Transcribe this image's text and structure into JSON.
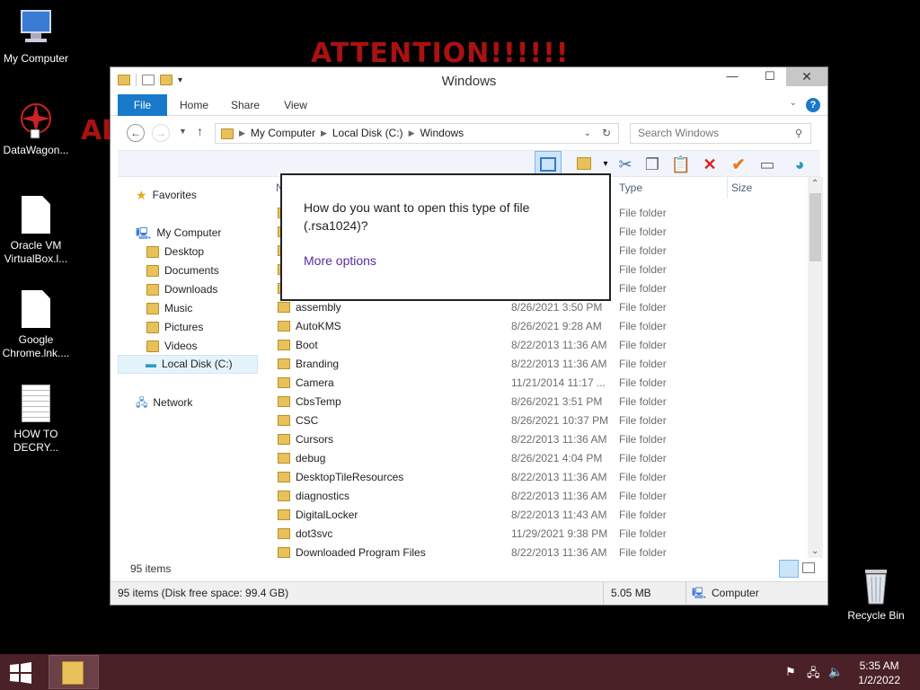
{
  "ransom": {
    "line1": "ATTENTION!!!!!!",
    "line2": "AL"
  },
  "desktop_icons": [
    {
      "label": "My Computer",
      "icon": "computer-icon"
    },
    {
      "label": "DataWagon...",
      "icon": "app-shortcut-icon"
    },
    {
      "label": "Oracle VM VirtualBox.l...",
      "icon": "file-icon"
    },
    {
      "label": "Google Chrome.lnk....",
      "icon": "file-icon"
    },
    {
      "label": "HOW TO DECRY...",
      "icon": "text-file-icon"
    },
    {
      "label": "Recycle Bin",
      "icon": "recycle-bin-icon"
    }
  ],
  "window": {
    "title": "Windows",
    "minimize": "—",
    "maximize": "☐",
    "close": "✕",
    "tabs": [
      "File",
      "Home",
      "Share",
      "View"
    ],
    "help": "?",
    "address": [
      "My Computer",
      "Local Disk (C:)",
      "Windows"
    ],
    "search_placeholder": "Search Windows"
  },
  "nav": {
    "favorites": "Favorites",
    "my_computer": "My Computer",
    "desktop": "Desktop",
    "documents": "Documents",
    "downloads": "Downloads",
    "music": "Music",
    "pictures": "Pictures",
    "videos": "Videos",
    "local_disk": "Local Disk (C:)",
    "network": "Network"
  },
  "columns": {
    "name": "N",
    "type": "Type",
    "size": "Size"
  },
  "files": [
    {
      "name": "",
      "date": "",
      "type": "File folder"
    },
    {
      "name": "",
      "date": "",
      "type": "File folder"
    },
    {
      "name": "",
      "date": "",
      "type": "File folder"
    },
    {
      "name": "",
      "date": "",
      "type": "File folder"
    },
    {
      "name": "",
      "date": "",
      "type": "File folder"
    },
    {
      "name": "assembly",
      "date": "8/26/2021 3:50 PM",
      "type": "File folder"
    },
    {
      "name": "AutoKMS",
      "date": "8/26/2021 9:28 AM",
      "type": "File folder"
    },
    {
      "name": "Boot",
      "date": "8/22/2013 11:36 AM",
      "type": "File folder"
    },
    {
      "name": "Branding",
      "date": "8/22/2013 11:36 AM",
      "type": "File folder"
    },
    {
      "name": "Camera",
      "date": "11/21/2014 11:17 ...",
      "type": "File folder"
    },
    {
      "name": "CbsTemp",
      "date": "8/26/2021 3:51 PM",
      "type": "File folder"
    },
    {
      "name": "CSC",
      "date": "8/26/2021 10:37 PM",
      "type": "File folder"
    },
    {
      "name": "Cursors",
      "date": "8/22/2013 11:36 AM",
      "type": "File folder"
    },
    {
      "name": "debug",
      "date": "8/26/2021 4:04 PM",
      "type": "File folder"
    },
    {
      "name": "DesktopTileResources",
      "date": "8/22/2013 11:36 AM",
      "type": "File folder"
    },
    {
      "name": "diagnostics",
      "date": "8/22/2013 11:36 AM",
      "type": "File folder"
    },
    {
      "name": "DigitalLocker",
      "date": "8/22/2013 11:43 AM",
      "type": "File folder"
    },
    {
      "name": "dot3svc",
      "date": "11/29/2021 9:38 PM",
      "type": "File folder"
    },
    {
      "name": "Downloaded Program Files",
      "date": "8/22/2013 11:36 AM",
      "type": "File folder"
    }
  ],
  "item_count": "95 items",
  "status": {
    "left": "95 items (Disk free space: 99.4 GB)",
    "size": "5.05 MB",
    "location": "Computer"
  },
  "popup": {
    "question": "How do you want to open this type of file (.rsa1024)?",
    "more": "More options"
  },
  "clock": {
    "time": "5:35 AM",
    "date": "1/2/2022"
  }
}
